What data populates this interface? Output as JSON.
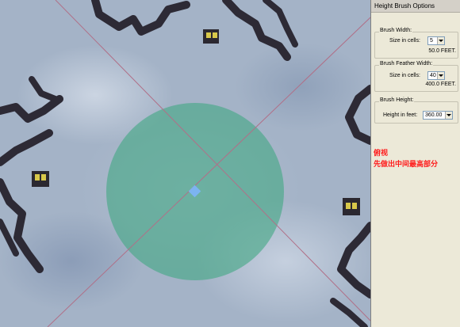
{
  "panel": {
    "title": "Height Brush Options",
    "brush_width": {
      "label": "Brush Width:",
      "field_label": "Size in cells:",
      "value": "5",
      "feet": "50.0 FEET."
    },
    "brush_feather": {
      "label": "Brush Feather Width:",
      "field_label": "Size in cells:",
      "value": "40",
      "feet": "400.0 FEET."
    },
    "brush_height": {
      "label": "Brush Height:",
      "field_label": "Height in feet:",
      "value": "360.00"
    }
  },
  "annotation": {
    "line1": "俯视",
    "line2": "先做出中间最高部分"
  },
  "colors": {
    "brush_circle": "#43a885",
    "crosshair": "#b07088",
    "center_marker": "#7fb5ff",
    "annotation": "#ff1a1a"
  },
  "icons": {
    "dropdown": "chevron-down-icon"
  }
}
